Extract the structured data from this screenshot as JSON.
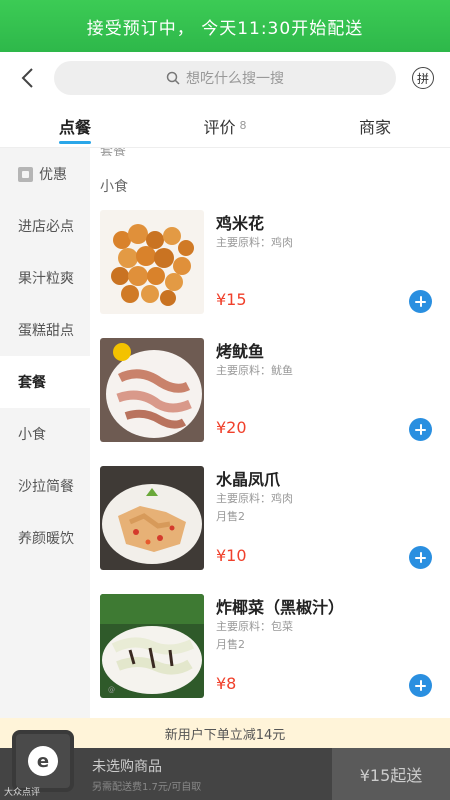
{
  "banner": {
    "text": "接受预订中， 今天11:30开始配送"
  },
  "search": {
    "placeholder": "想吃什么搜一搜"
  },
  "header": {
    "pin_label": "拼"
  },
  "tabs": [
    {
      "label": "点餐",
      "count": ""
    },
    {
      "label": "评价",
      "count": "8"
    },
    {
      "label": "商家",
      "count": ""
    }
  ],
  "sidebar": {
    "items": [
      {
        "label": "优惠"
      },
      {
        "label": "进店必点"
      },
      {
        "label": "果汁粒爽"
      },
      {
        "label": "蛋糕甜点"
      },
      {
        "label": "套餐"
      },
      {
        "label": "小食"
      },
      {
        "label": "沙拉简餐"
      },
      {
        "label": "养颜暖饮"
      }
    ]
  },
  "content": {
    "peek_label": "套餐",
    "section_title": "小食",
    "items": [
      {
        "name": "鸡米花",
        "ingredient": "主要原料：鸡肉",
        "sold": "",
        "price": "¥15"
      },
      {
        "name": "烤鱿鱼",
        "ingredient": "主要原料：鱿鱼",
        "sold": "",
        "price": "¥20"
      },
      {
        "name": "水晶凤爪",
        "ingredient": "主要原料：鸡肉",
        "sold": "月售2",
        "price": "¥10"
      },
      {
        "name": "炸椰菜（黑椒汁）",
        "ingredient": "主要原料：包菜",
        "sold": "月售2",
        "price": "¥8"
      }
    ]
  },
  "promo": {
    "text": "新用户下单立减14元"
  },
  "cart": {
    "title": "未选购商品",
    "subtitle": "另需配送费1.7元/可自取",
    "checkout_label": "¥15起送",
    "watermark": "大众点评"
  },
  "colors": {
    "brand_green": "#2eb84a",
    "accent_blue": "#2a8fe0",
    "price_red": "#f0402b"
  }
}
